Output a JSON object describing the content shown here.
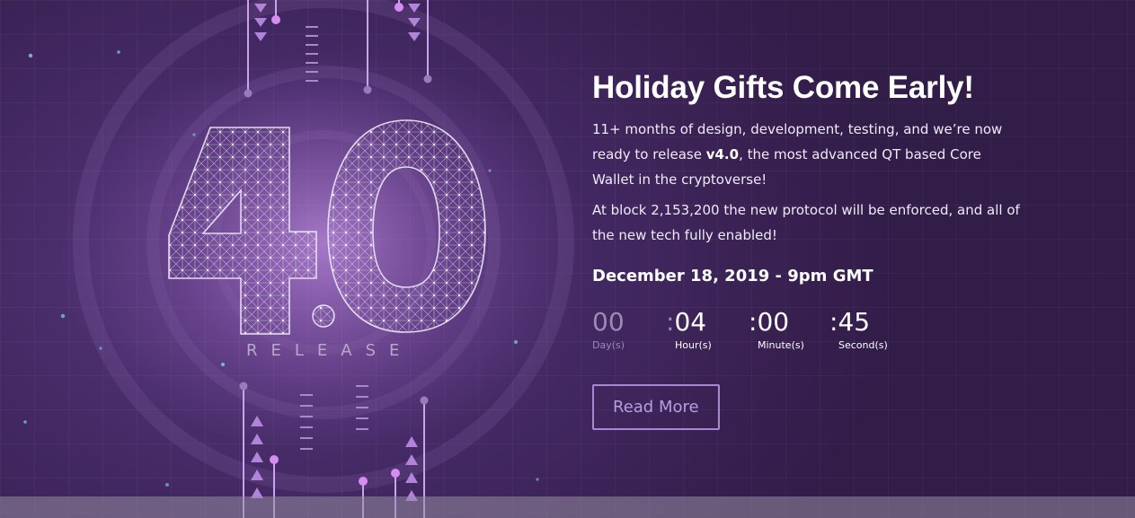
{
  "hero": {
    "graphic": {
      "version_text": "4.0",
      "release_label": "RELEASE"
    },
    "title": "Holiday Gifts Come Early!",
    "paragraph1": {
      "before": "11+ months of design, development, testing, and we’re now ready to release ",
      "bold": "v4.0",
      "after": ", the most advanced QT based Core Wallet in the cryptoverse!"
    },
    "paragraph2": "At block 2,153,200 the new protocol will be enforced, and all of the new tech fully enabled!",
    "date": "December 18, 2019 - 9pm GMT",
    "countdown": {
      "days": {
        "value": "00",
        "label": "Day(s)"
      },
      "hours": {
        "value": "04",
        "label": "Hour(s)"
      },
      "minutes": {
        "value": "00",
        "label": "Minute(s)"
      },
      "seconds": {
        "value": "45",
        "label": "Second(s)"
      },
      "separator": ":"
    },
    "button": {
      "label": "Read More"
    }
  },
  "colors": {
    "background": "#3b2250",
    "accent": "#a787d2",
    "button_text": "#b89de0",
    "muted": "#9e8ab2"
  }
}
